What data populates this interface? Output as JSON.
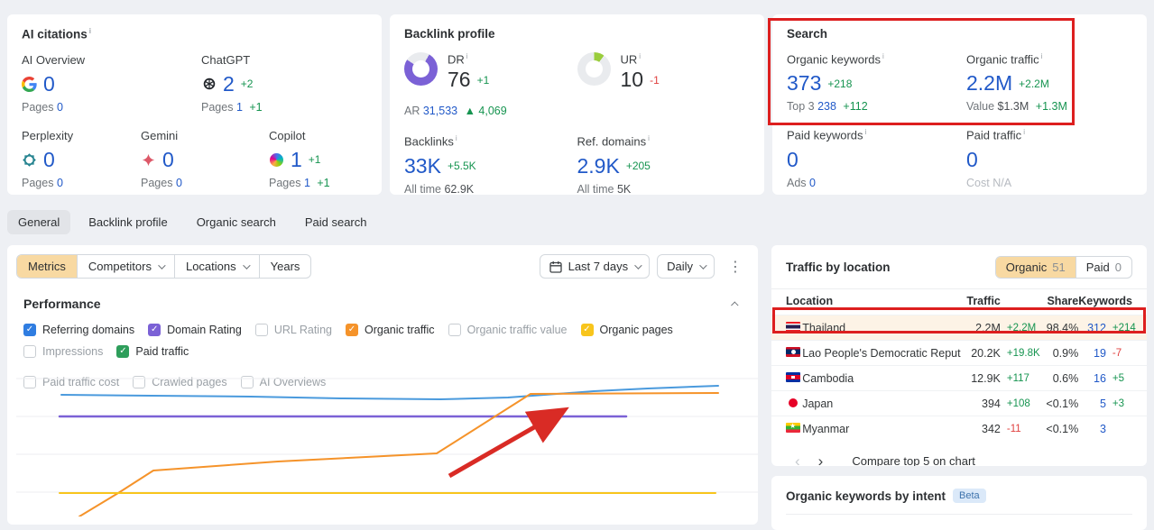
{
  "ui": {
    "info_mark": "i"
  },
  "cards": {
    "ai_citations": {
      "title": "AI citations",
      "items": [
        {
          "name": "AI Overview",
          "value": "0",
          "delta": "",
          "pages_label": "Pages",
          "pages": "0",
          "pages_delta": ""
        },
        {
          "name": "ChatGPT",
          "value": "2",
          "delta": "+2",
          "pages_label": "Pages",
          "pages": "1",
          "pages_delta": "+1"
        },
        {
          "name": "Perplexity",
          "value": "0",
          "delta": "",
          "pages_label": "Pages",
          "pages": "0",
          "pages_delta": ""
        },
        {
          "name": "Gemini",
          "value": "0",
          "delta": "",
          "pages_label": "Pages",
          "pages": "0",
          "pages_delta": ""
        },
        {
          "name": "Copilot",
          "value": "1",
          "delta": "+1",
          "pages_label": "Pages",
          "pages": "1",
          "pages_delta": "+1"
        }
      ]
    },
    "backlink_profile": {
      "title": "Backlink profile",
      "dr": {
        "label": "DR",
        "value": "76",
        "delta": "+1",
        "percent": 76,
        "ar_label": "AR",
        "ar_value": "31,533",
        "ar_delta": "▲ 4,069"
      },
      "ur": {
        "label": "UR",
        "value": "10",
        "delta": "-1",
        "percent": 10
      },
      "backlinks": {
        "label": "Backlinks",
        "value": "33K",
        "delta": "+5.5K",
        "alltime_label": "All time",
        "alltime": "62.9K"
      },
      "ref_domains": {
        "label": "Ref. domains",
        "value": "2.9K",
        "delta": "+205",
        "alltime_label": "All time",
        "alltime": "5K"
      }
    },
    "search": {
      "title": "Search",
      "organic_keywords": {
        "label": "Organic keywords",
        "value": "373",
        "delta": "+218",
        "sub_label": "Top 3",
        "sub_value": "238",
        "sub_delta": "+112"
      },
      "organic_traffic": {
        "label": "Organic traffic",
        "value": "2.2M",
        "delta": "+2.2M",
        "sub_label": "Value",
        "sub_value": "$1.3M",
        "sub_delta": "+1.3M"
      },
      "paid_keywords": {
        "label": "Paid keywords",
        "value": "0",
        "sub_label": "Ads",
        "sub_value": "0"
      },
      "paid_traffic": {
        "label": "Paid traffic",
        "value": "0",
        "sub_label": "Cost",
        "sub_value": "N/A"
      }
    }
  },
  "tabs": [
    "General",
    "Backlink profile",
    "Organic search",
    "Paid search"
  ],
  "controls": {
    "segmented": [
      "Metrics",
      "Competitors",
      "Locations",
      "Years"
    ],
    "date_range": "Last 7 days",
    "granularity": "Daily"
  },
  "performance": {
    "title": "Performance",
    "checkboxes": [
      {
        "label": "Referring domains",
        "checked": true,
        "color": "#2f7de1"
      },
      {
        "label": "Domain Rating",
        "checked": true,
        "color": "#7b61d6"
      },
      {
        "label": "URL Rating",
        "checked": false,
        "color": ""
      },
      {
        "label": "Organic traffic",
        "checked": true,
        "color": "#f5932a"
      },
      {
        "label": "Organic traffic value",
        "checked": false,
        "color": ""
      },
      {
        "label": "Organic pages",
        "checked": true,
        "color": "#f8c51c"
      },
      {
        "label": "Impressions",
        "checked": false,
        "color": ""
      },
      {
        "label": "Paid traffic",
        "checked": true,
        "color": "#2e9e5b"
      },
      {
        "label": "Paid traffic cost",
        "checked": false,
        "color": ""
      },
      {
        "label": "Crawled pages",
        "checked": false,
        "color": ""
      },
      {
        "label": "AI Overviews",
        "checked": false,
        "color": ""
      }
    ]
  },
  "chart_data": {
    "type": "line",
    "title": "Performance",
    "x_axis": "time (last 7 days, daily, axis labels cut off)",
    "gridlines_y": [
      25,
      67,
      109,
      151
    ],
    "series": [
      {
        "name": "Referring domains",
        "color": "#4a9add",
        "width": 2,
        "points": [
          [
            50,
            43
          ],
          [
            150,
            44
          ],
          [
            260,
            45
          ],
          [
            360,
            47
          ],
          [
            470,
            48
          ],
          [
            545,
            46
          ],
          [
            640,
            39
          ],
          [
            700,
            36
          ],
          [
            778,
            33
          ]
        ]
      },
      {
        "name": "Domain Rating",
        "color": "#7b61d6",
        "width": 2.5,
        "points": [
          [
            48,
            67
          ],
          [
            676,
            67
          ]
        ]
      },
      {
        "name": "Organic traffic",
        "color": "#f5932a",
        "width": 2,
        "points": [
          [
            70,
            178
          ],
          [
            113,
            152
          ],
          [
            152,
            127
          ],
          [
            290,
            117
          ],
          [
            466,
            108
          ],
          [
            570,
            42
          ],
          [
            778,
            41
          ]
        ]
      },
      {
        "name": "Organic pages",
        "color": "#f8c51c",
        "width": 2,
        "points": [
          [
            48,
            152
          ],
          [
            775,
            152
          ]
        ]
      }
    ],
    "annotation_arrow": {
      "from": [
        480,
        133
      ],
      "to": [
        602,
        63
      ],
      "color": "#d92b25"
    }
  },
  "traffic_by_location": {
    "title": "Traffic by location",
    "toggle": [
      {
        "label": "Organic",
        "count": "51",
        "active": true
      },
      {
        "label": "Paid",
        "count": "0",
        "active": false
      }
    ],
    "columns": {
      "location": "Location",
      "traffic": "Traffic",
      "share": "Share",
      "keywords": "Keywords"
    },
    "rows": [
      {
        "location": "Thailand",
        "flag": "th",
        "traffic": "2.2M",
        "traffic_delta": "+2.2M",
        "share": "98.4%",
        "keywords": "312",
        "keywords_delta": "+214",
        "highlight": true
      },
      {
        "location": "Lao People's Democratic Reput",
        "flag": "la",
        "traffic": "20.2K",
        "traffic_delta": "+19.8K",
        "share": "0.9%",
        "keywords": "19",
        "keywords_delta": "-7",
        "highlight": false
      },
      {
        "location": "Cambodia",
        "flag": "kh",
        "traffic": "12.9K",
        "traffic_delta": "+117",
        "share": "0.6%",
        "keywords": "16",
        "keywords_delta": "+5",
        "highlight": false
      },
      {
        "location": "Japan",
        "flag": "jp",
        "traffic": "394",
        "traffic_delta": "+108",
        "share": "<0.1%",
        "keywords": "5",
        "keywords_delta": "+3",
        "highlight": false
      },
      {
        "location": "Myanmar",
        "flag": "mm",
        "traffic": "342",
        "traffic_delta": "-11",
        "share": "<0.1%",
        "keywords": "3",
        "keywords_delta": "",
        "highlight": false
      }
    ],
    "footer_action": "Compare top 5 on chart"
  },
  "organic_keywords_by_intent": {
    "title": "Organic keywords by intent",
    "badge": "Beta"
  }
}
